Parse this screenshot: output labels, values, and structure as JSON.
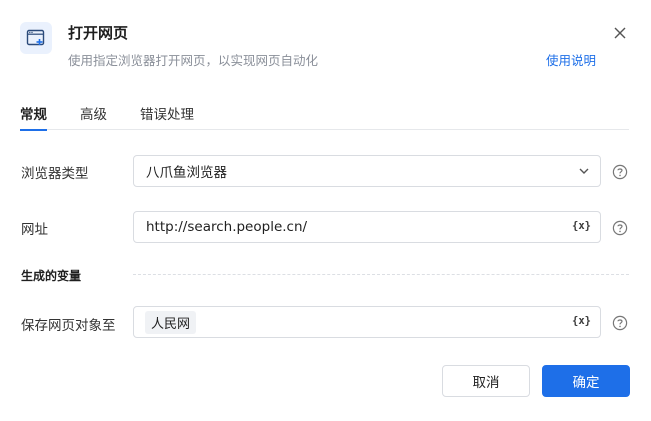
{
  "dialog": {
    "title": "打开网页",
    "subtitle": "使用指定浏览器打开网页，以实现网页自动化",
    "help_link": "使用说明"
  },
  "tabs": [
    {
      "label": "常规",
      "active": true
    },
    {
      "label": "高级",
      "active": false
    },
    {
      "label": "错误处理",
      "active": false
    }
  ],
  "form": {
    "browser_type": {
      "label": "浏览器类型",
      "value": "八爪鱼浏览器"
    },
    "url": {
      "label": "网址",
      "value": "http://search.people.cn/",
      "var_button": "{x}"
    },
    "section_output": "生成的变量",
    "save_to": {
      "label": "保存网页对象至",
      "tag": "人民网",
      "var_button": "{x}"
    }
  },
  "buttons": {
    "cancel": "取消",
    "ok": "确定"
  },
  "colors": {
    "accent": "#1e6fe8",
    "icon_bg": "#eaf1fd"
  }
}
